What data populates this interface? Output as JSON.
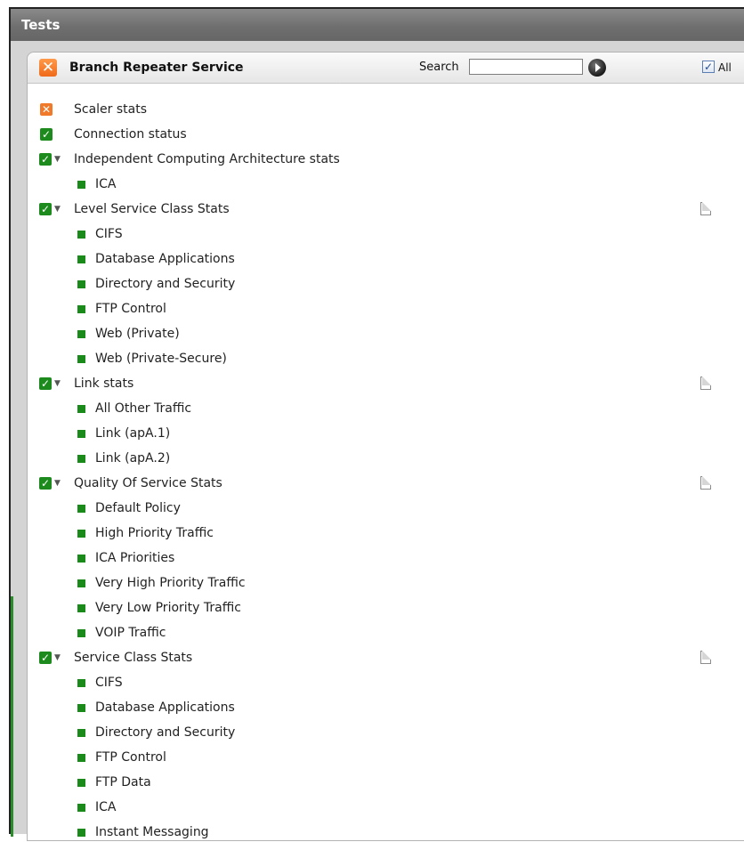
{
  "window": {
    "title": "Tests"
  },
  "panel": {
    "title": "Branch Repeater Service",
    "search_label": "Search",
    "search_value": "",
    "all_label": "All",
    "all_checked": true
  },
  "tree": [
    {
      "type": "top-x",
      "label": "Scaler stats"
    },
    {
      "type": "top-check",
      "label": "Connection status"
    },
    {
      "type": "group",
      "label": "Independent Computing Architecture stats",
      "doc": false
    },
    {
      "type": "child",
      "label": "ICA"
    },
    {
      "type": "group",
      "label": "Level Service Class Stats",
      "doc": true
    },
    {
      "type": "child",
      "label": "CIFS"
    },
    {
      "type": "child",
      "label": "Database Applications"
    },
    {
      "type": "child",
      "label": "Directory and Security"
    },
    {
      "type": "child",
      "label": "FTP Control"
    },
    {
      "type": "child",
      "label": "Web (Private)"
    },
    {
      "type": "child",
      "label": "Web (Private-Secure)"
    },
    {
      "type": "group",
      "label": "Link stats",
      "doc": true
    },
    {
      "type": "child",
      "label": "All Other Traffic"
    },
    {
      "type": "child",
      "label": "Link (apA.1)"
    },
    {
      "type": "child",
      "label": "Link (apA.2)"
    },
    {
      "type": "group",
      "label": "Quality Of Service Stats",
      "doc": true
    },
    {
      "type": "child",
      "label": "Default Policy"
    },
    {
      "type": "child",
      "label": "High Priority Traffic"
    },
    {
      "type": "child",
      "label": "ICA Priorities"
    },
    {
      "type": "child",
      "label": "Very High Priority Traffic"
    },
    {
      "type": "child",
      "label": "Very Low Priority Traffic"
    },
    {
      "type": "child",
      "label": "VOIP Traffic"
    },
    {
      "type": "group",
      "label": "Service Class Stats",
      "doc": true
    },
    {
      "type": "child",
      "label": "CIFS"
    },
    {
      "type": "child",
      "label": "Database Applications"
    },
    {
      "type": "child",
      "label": "Directory and Security"
    },
    {
      "type": "child",
      "label": "FTP Control"
    },
    {
      "type": "child",
      "label": "FTP Data"
    },
    {
      "type": "child",
      "label": "ICA"
    },
    {
      "type": "child",
      "label": "Instant Messaging"
    }
  ],
  "colors": {
    "check_green": "#1c8a1c",
    "close_orange": "#f07a2a",
    "title_bar": "#777777"
  }
}
